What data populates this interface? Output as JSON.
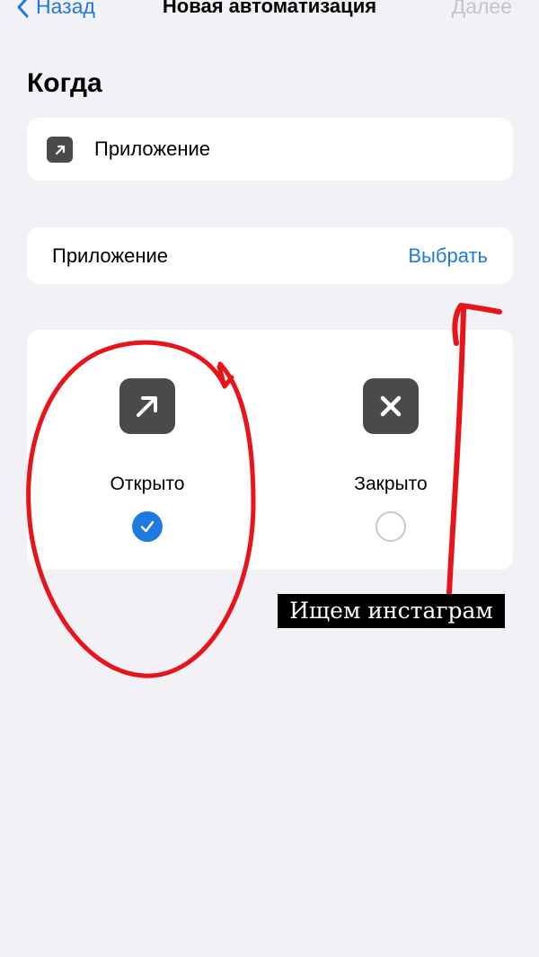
{
  "nav": {
    "back_label": "Назад",
    "title": "Новая автоматизация",
    "next_label": "Далее"
  },
  "section": {
    "title": "Когда"
  },
  "trigger": {
    "label": "Приложение",
    "icon": "arrow-up-right-icon"
  },
  "app_row": {
    "label": "Приложение",
    "action": "Выбрать"
  },
  "states": [
    {
      "label": "Открыто",
      "icon": "arrow-up-right-icon",
      "selected": true
    },
    {
      "label": "Закрыто",
      "icon": "close-x-icon",
      "selected": false
    }
  ],
  "annotation": {
    "caption": "Ищем инстаграм",
    "color": "#e8141b"
  },
  "colors": {
    "accent": "#1f7ae0",
    "background": "#f2f1f6",
    "icon_tile": "#4a4a4c",
    "disabled": "#c5c5c8"
  }
}
